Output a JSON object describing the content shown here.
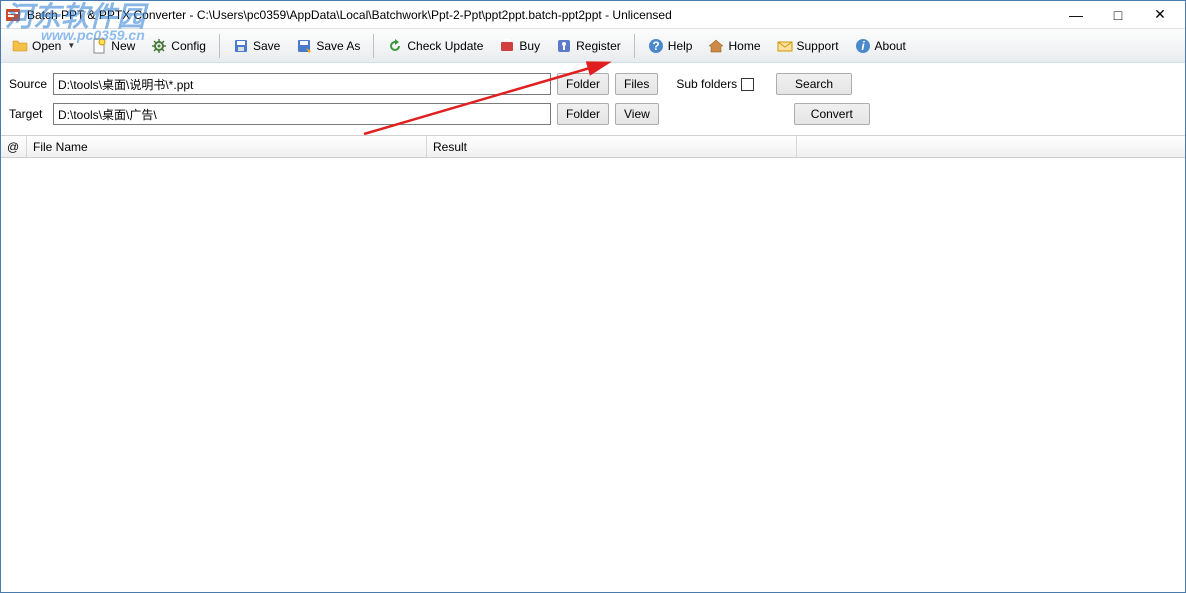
{
  "window": {
    "title": "Batch PPT & PPTX Converter - C:\\Users\\pc0359\\AppData\\Local\\Batchwork\\Ppt-2-Ppt\\ppt2ppt.batch-ppt2ppt - Unlicensed"
  },
  "toolbar": {
    "open": "Open",
    "new": "New",
    "config": "Config",
    "save": "Save",
    "save_as": "Save As",
    "check_update": "Check Update",
    "buy": "Buy",
    "register": "Register",
    "help": "Help",
    "home": "Home",
    "support": "Support",
    "about": "About"
  },
  "form": {
    "source_label": "Source",
    "source_value": "D:\\tools\\桌面\\说明书\\*.ppt",
    "target_label": "Target",
    "target_value": "D:\\tools\\桌面\\广告\\",
    "folder_btn": "Folder",
    "files_btn": "Files",
    "view_btn": "View",
    "subfolders_label": "Sub folders",
    "search_btn": "Search",
    "convert_btn": "Convert"
  },
  "list": {
    "col_at": "@",
    "col_filename": "File Name",
    "col_result": "Result"
  },
  "watermark": {
    "main": "河东软件园",
    "sub": "www.pc0359.cn"
  }
}
